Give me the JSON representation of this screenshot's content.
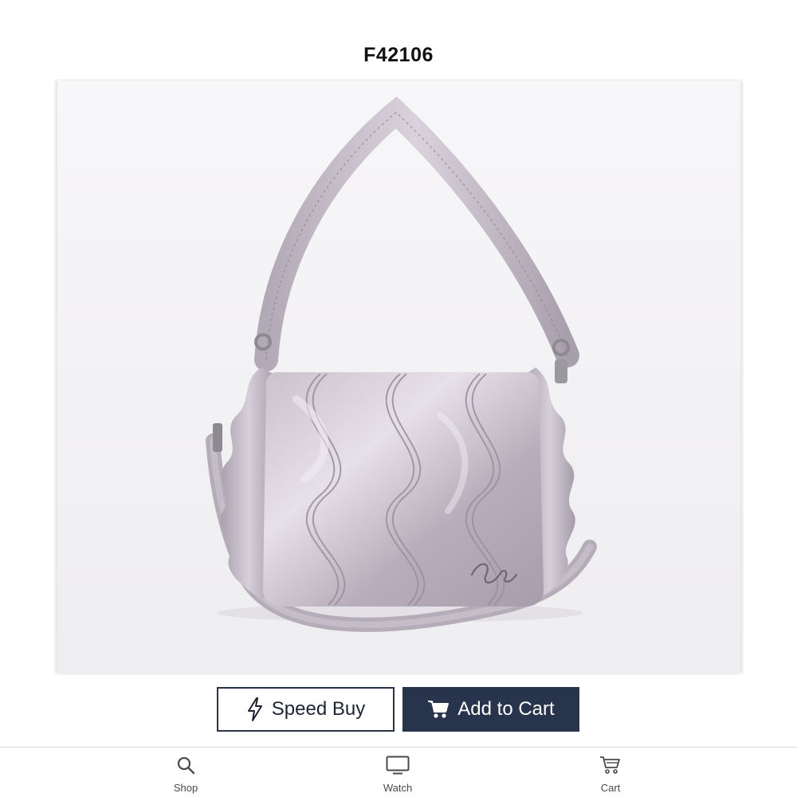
{
  "corner_glyph": ")",
  "product": {
    "item_number": "F42106",
    "image_alt": "Lilac satin quilted shoulder bag with ruffled sides and crossbody strap"
  },
  "actions": {
    "speed_buy_label": "Speed Buy",
    "speed_buy_icon": "lightning-bolt-icon",
    "add_to_cart_label": "Add to Cart",
    "add_to_cart_icon": "cart-icon",
    "accent_color": "#27344c"
  },
  "tabbar": {
    "items": [
      {
        "label": "Shop",
        "icon": "search-icon"
      },
      {
        "label": "Watch",
        "icon": "tv-icon"
      },
      {
        "label": "Cart",
        "icon": "cart-icon"
      }
    ]
  }
}
